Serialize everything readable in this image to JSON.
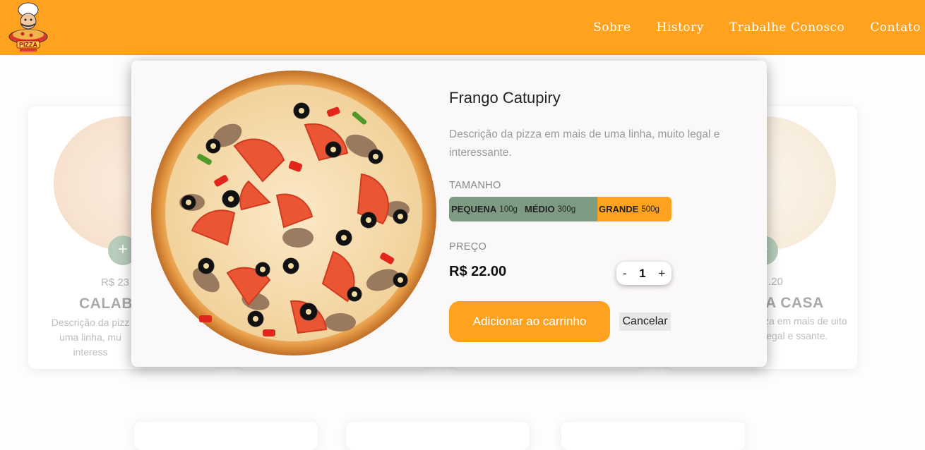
{
  "nav": {
    "logo_text": "PIZZA",
    "items": [
      "Sobre",
      "History",
      "Trabalhe Conosco",
      "Contato"
    ]
  },
  "cards": [
    {
      "price": "R$ 23",
      "name": "CALABR",
      "desc": "Descrição da pizz uma linha, mu interess"
    },
    {
      "price": ".20",
      "name": "A CASA",
      "desc": "za em mais de uito legal e ssante."
    }
  ],
  "modal": {
    "title": "Frango Catupiry",
    "description": "Descrição da pizza em mais de uma linha, muito legal e interessante.",
    "size_label": "TAMANHO",
    "sizes": [
      {
        "name": "PEQUENA",
        "weight": "100g",
        "selected": false
      },
      {
        "name": "MÉDIO",
        "weight": "300g",
        "selected": false
      },
      {
        "name": "GRANDE",
        "weight": "500g",
        "selected": true
      }
    ],
    "price_label": "PREÇO",
    "price": "R$ 22.00",
    "qty_minus": "-",
    "qty_value": "1",
    "qty_plus": "+",
    "add_button": "Adicionar ao carrinho",
    "cancel_button": "Cancelar"
  },
  "colors": {
    "accent": "#ffa21f",
    "size_unselected": "#7d9b83",
    "plus_button": "#b7ccbb"
  }
}
